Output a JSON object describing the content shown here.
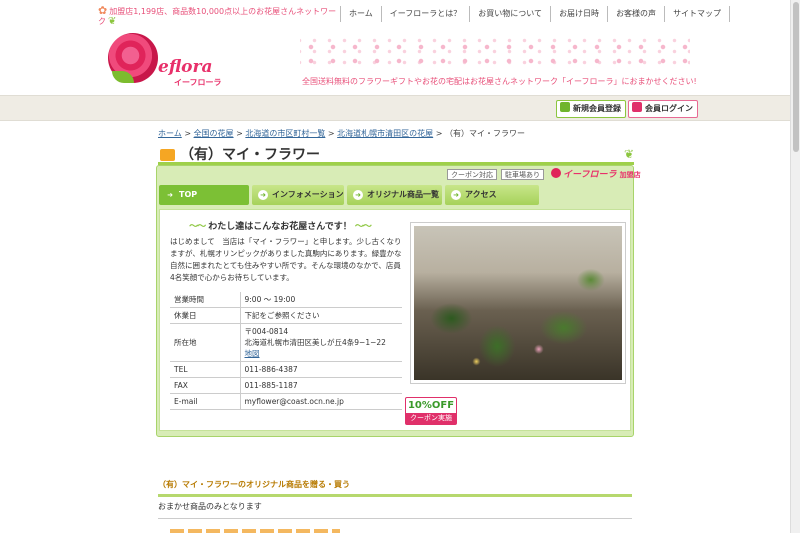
{
  "top": {
    "news": "加盟店1,199店、商品数10,000点以上のお花屋さんネットワーク",
    "nav": [
      "ホーム",
      "イーフローラとは？",
      "お買い物について",
      "お届け日時",
      "お客様の声",
      "サイトマップ"
    ]
  },
  "header": {
    "logo_text": "eflora",
    "logo_sub": "イーフローラ",
    "tagline": "全国送料無料のフラワーギフトやお花の宅配はお花屋さんネットワーク「イーフローラ」におまかせください!"
  },
  "member": {
    "register_label": "新規会員登録",
    "login_label": "会員ログイン"
  },
  "breadcrumb": {
    "home": "ホーム",
    "sep": ">",
    "national": "全国の花屋",
    "hokkaido": "北海道の市区町村一覧",
    "kiyota": "北海道札幌市清田区の花屋",
    "current": "（有）マイ・フラワー"
  },
  "shop": {
    "title": "（有）マイ・フラワー",
    "tags": [
      "クーポン対応",
      "駐車場あり"
    ],
    "member_brand": "イーフローラ",
    "member_suffix": "加盟店",
    "tabs": [
      {
        "label": "TOP",
        "active": true
      },
      {
        "label": "インフォメーション",
        "active": false
      },
      {
        "label": "オリジナル商品一覧",
        "active": false
      },
      {
        "label": "アクセス",
        "active": false
      }
    ],
    "intro_heading": "わたし達はこんなお花屋さんです！",
    "intro_text": "はじめまして　当店は「マイ・フラワー」と申します。少し古くなりますが、札幌オリンピックがありました真駒内にあります。緑豊かな自然に囲まれたとても住みやすい所です。そんな環境のなかで、店員4名笑顔で心からお待ちしています。",
    "info": {
      "hours_label": "営業時間",
      "hours": "9:00 〜 19:00",
      "closed_label": "休業日",
      "closed": "下記をご参照ください",
      "address_label": "所在地",
      "postal": "〒004-0814",
      "address": "北海道札幌市清田区美しが丘4条9−1−22",
      "map_link": "地図",
      "tel_label": "TEL",
      "tel": "011-886-4387",
      "fax_label": "FAX",
      "fax": "011-885-1187",
      "email_label": "E-mail",
      "email": "myflower@coast.ocn.ne.jp"
    },
    "coupon_percent": "10%OFF",
    "coupon_label": "クーポン実施"
  },
  "products": {
    "heading": "（有）マイ・フラワーのオリジナル商品を贈る・買う",
    "note": "おまかせ商品のみとなります"
  },
  "colors": {
    "brand_pink": "#e8306a",
    "green": "#8cc63f",
    "panel_bg": "#d8ecb6"
  },
  "icons": {
    "news_icon": "flower-icon",
    "register_icon": "register-icon",
    "login_icon": "lock-icon"
  }
}
